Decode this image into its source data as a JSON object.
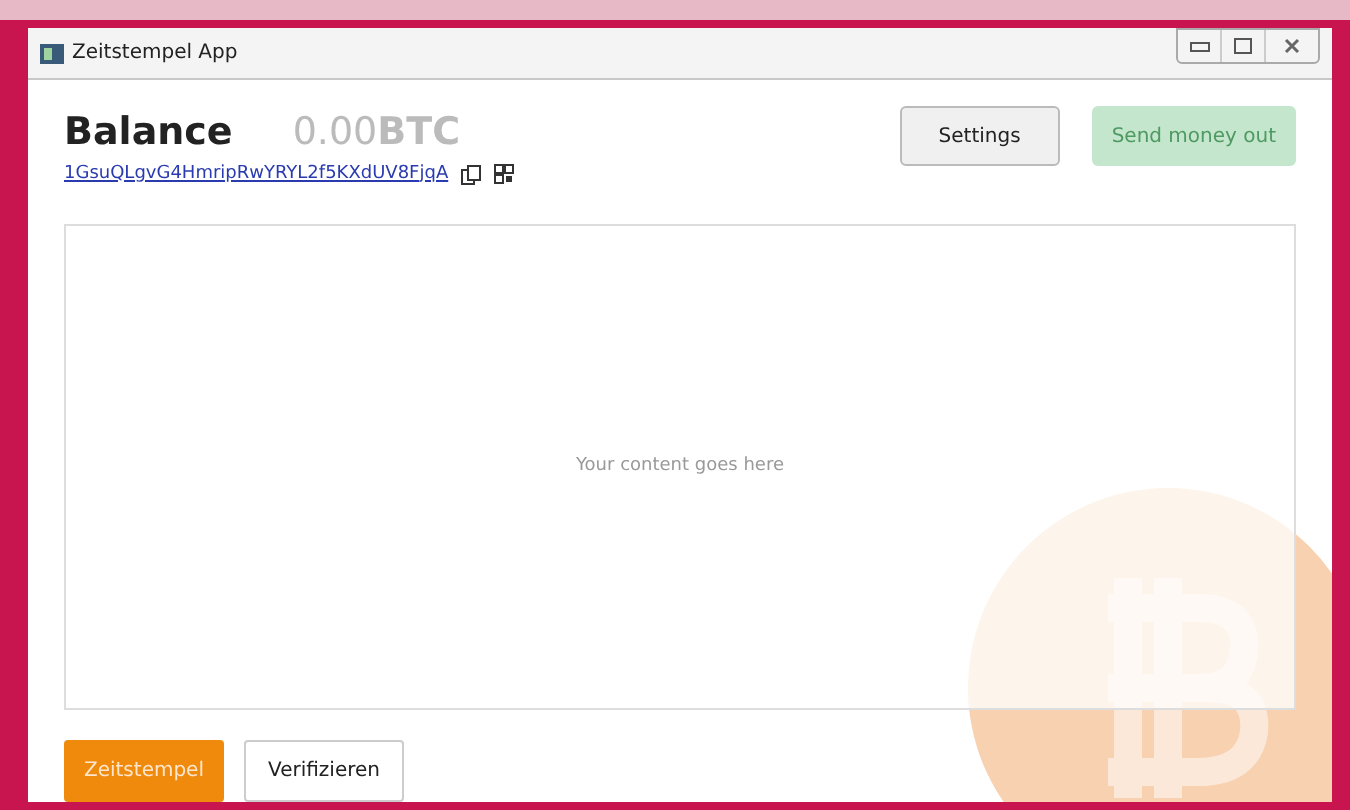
{
  "window": {
    "title": "Zeitstempel App"
  },
  "header": {
    "label": "Balance",
    "amount": "0.00**BTC**",
    "address": "1GsuQLgvG4HmripRwYRYL2f5KXdUV8FjqA"
  },
  "toolbar_buttons": [
    {
      "label": "Settings",
      "disabled": false
    },
    {
      "label": "Send money out",
      "disabled": true
    }
  ],
  "content": {
    "placeholder_text": "Your content goes here"
  },
  "bottom_buttons": [
    {
      "label": "Zeitstempel",
      "kind": "primary"
    },
    {
      "label": "Verifizieren",
      "kind": "secondary"
    }
  ]
}
